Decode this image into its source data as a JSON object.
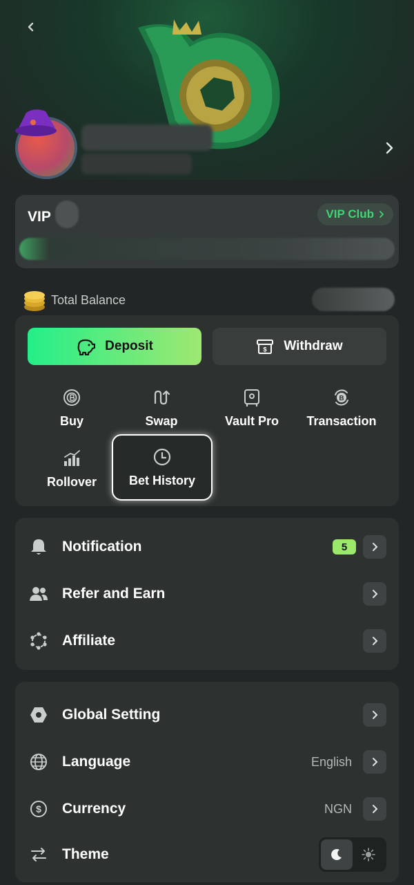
{
  "header": {
    "back_icon": "chevron-left-icon",
    "forward_icon": "chevron-right-icon"
  },
  "vip": {
    "title": "VIP",
    "club_label": "VIP Club",
    "accent_color": "#3fd476"
  },
  "balance": {
    "label": "Total Balance"
  },
  "wallet": {
    "deposit_label": "Deposit",
    "withdraw_label": "Withdraw",
    "actions": [
      {
        "label": "Buy",
        "icon": "bitcoin-coin-icon"
      },
      {
        "label": "Swap",
        "icon": "swap-arrows-icon"
      },
      {
        "label": "Vault Pro",
        "icon": "vault-icon"
      },
      {
        "label": "Transaction",
        "icon": "bitcoin-transfer-icon"
      },
      {
        "label": "Rollover",
        "icon": "bar-chart-icon"
      },
      {
        "label": "Bet History",
        "icon": "clock-icon"
      }
    ]
  },
  "menu1": [
    {
      "label": "Notification",
      "badge": "5",
      "icon": "bell-icon"
    },
    {
      "label": "Refer and Earn",
      "icon": "users-icon"
    },
    {
      "label": "Affiliate",
      "icon": "network-icon"
    }
  ],
  "menu2": [
    {
      "label": "Global Setting",
      "icon": "hexagon-gear-icon"
    },
    {
      "label": "Language",
      "value": "English",
      "icon": "globe-icon"
    },
    {
      "label": "Currency",
      "value": "NGN",
      "icon": "dollar-circle-icon"
    },
    {
      "label": "Theme",
      "icon": "swap-horizontal-icon"
    }
  ],
  "colors": {
    "background": "#232626",
    "card": "#2d3231",
    "deposit_gradient_start": "#24ee89",
    "deposit_gradient_end": "#9fe871",
    "badge": "#9be86a"
  }
}
